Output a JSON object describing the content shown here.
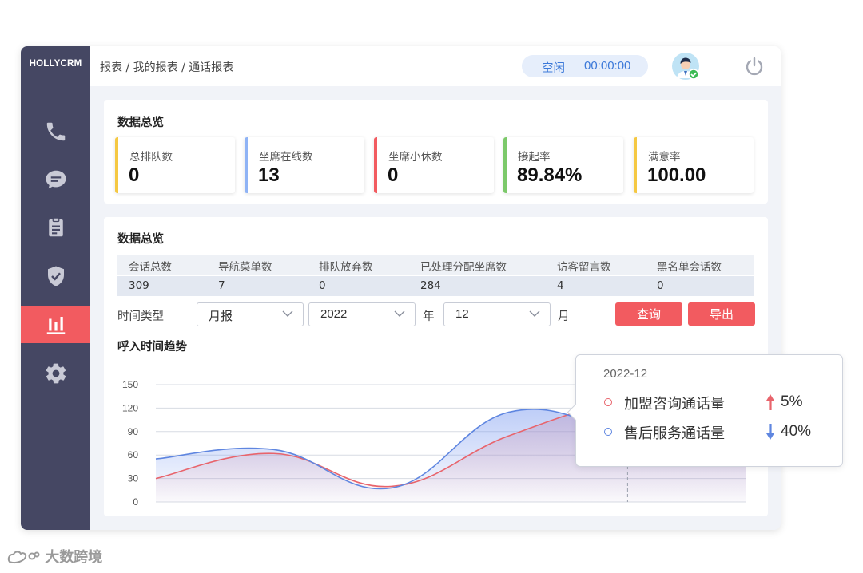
{
  "app": {
    "logo": "HOLLYCRM"
  },
  "sidebar": {
    "items": [
      {
        "icon": "phone-icon"
      },
      {
        "icon": "chat-bubble-icon"
      },
      {
        "icon": "clipboard-icon"
      },
      {
        "icon": "shield-check-icon"
      },
      {
        "icon": "bar-chart-icon",
        "active": true
      },
      {
        "icon": "gear-icon"
      }
    ]
  },
  "header": {
    "breadcrumb": "报表 / 我的报表 / 通话报表",
    "status_label": "空闲",
    "status_timer": "00:00:00",
    "avatar_icon": "user-avatar-icon",
    "power_icon": "power-icon"
  },
  "overview": {
    "title": "数据总览",
    "stats": [
      {
        "label": "总排队数",
        "value": "0",
        "color": "#f5c842"
      },
      {
        "label": "坐席在线数",
        "value": "13",
        "color": "#8fb3f5"
      },
      {
        "label": "坐席小休数",
        "value": "0",
        "color": "#f25b60"
      },
      {
        "label": "接起率",
        "value": "89.84%",
        "color": "#7cc96a"
      },
      {
        "label": "满意率",
        "value": "100.00",
        "color": "#f5c842"
      }
    ]
  },
  "details": {
    "title": "数据总览",
    "columns": [
      "会话总数",
      "导航菜单数",
      "排队放弃数",
      "已处理分配坐席数",
      "访客留言数",
      "黑名单会话数"
    ],
    "row": [
      "309",
      "7",
      "0",
      "284",
      "4",
      "0"
    ],
    "filter": {
      "time_type_label": "时间类型",
      "time_type_value": "月报",
      "year_value": "2022",
      "year_unit": "年",
      "month_value": "12",
      "month_unit": "月",
      "query_button": "查询",
      "export_button": "导出"
    }
  },
  "trend": {
    "title": "呼入时间趋势"
  },
  "chart_data": {
    "type": "area",
    "title": "呼入时间趋势",
    "ylim": [
      0,
      150
    ],
    "yticks": [
      "150",
      "120",
      "90",
      "60",
      "30",
      "0"
    ],
    "grid": true,
    "series": [
      {
        "name": "加盟咨询通话量",
        "color": "#e8646c",
        "points": [
          [
            0,
            30
          ],
          [
            1,
            62
          ],
          [
            2,
            20
          ],
          [
            3,
            85
          ],
          [
            4,
            128
          ],
          [
            5,
            122
          ]
        ]
      },
      {
        "name": "售后服务通话量",
        "color": "#5f86e0",
        "points": [
          [
            0,
            55
          ],
          [
            1,
            67
          ],
          [
            2,
            18
          ],
          [
            3,
            115
          ],
          [
            4,
            87
          ],
          [
            5,
            52
          ]
        ]
      }
    ],
    "highlight_index": 4
  },
  "tooltip": {
    "date": "2022-12",
    "rows": [
      {
        "name": "加盟咨询通话量",
        "direction": "up",
        "pct": "5%",
        "color": "#e8646c"
      },
      {
        "name": "售后服务通话量",
        "direction": "down",
        "pct": "40%",
        "color": "#5f86e0"
      }
    ]
  },
  "watermark": {
    "text": "大数跨境"
  }
}
